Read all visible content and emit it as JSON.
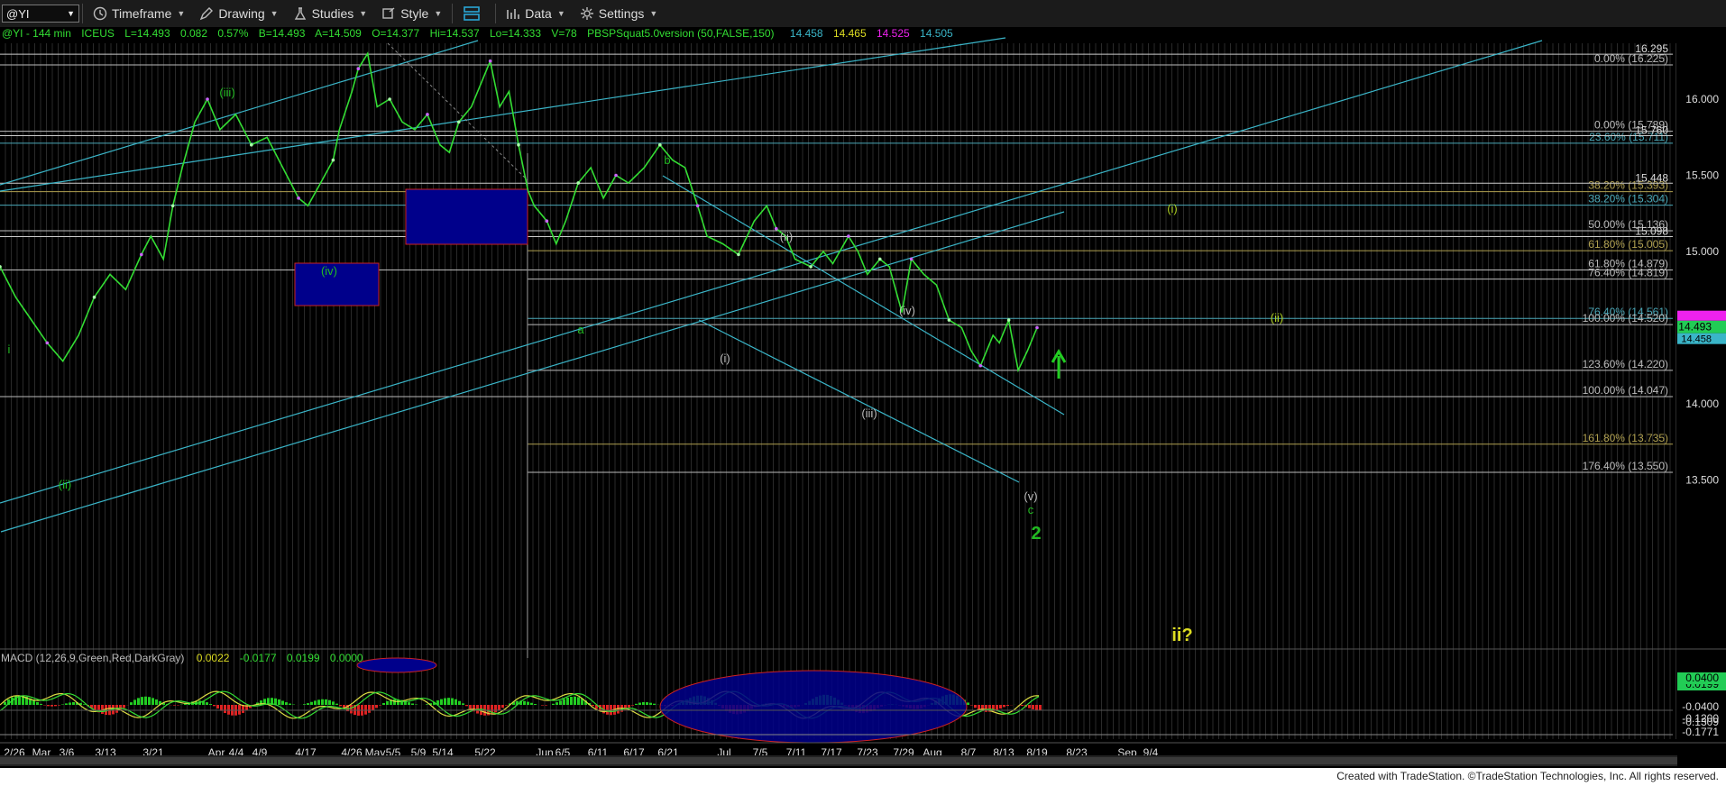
{
  "toolbar": {
    "symbol": "@YI",
    "timeframe": "Timeframe",
    "drawing": "Drawing",
    "studies": "Studies",
    "style": "Style",
    "data": "Data",
    "settings": "Settings"
  },
  "info_bar": {
    "symbol_interval": "@YI - 144 min",
    "exchange": "ICEUS",
    "last": "L=14.493",
    "change": "0.082",
    "change_pct": "0.57%",
    "bid": "B=14.493",
    "ask": "A=14.509",
    "open": "O=14.377",
    "high": "Hi=14.537",
    "low": "Lo=14.333",
    "volume": "V=78",
    "study": "PBSPSquat5.0version (50,FALSE,150)",
    "study_values": [
      "14.458",
      "14.465",
      "14.525",
      "14.505"
    ]
  },
  "macd": {
    "title": "MACD (12,26,9,Green,Red,DarkGray)",
    "values": [
      "0.0022",
      "-0.0177",
      "0.0199",
      "0.0000"
    ]
  },
  "footer": "Created with TradeStation. ©TradeStation Technologies, Inc. All rights reserved.",
  "colors": {
    "price": "#33dd33",
    "channel": "#3ab5c8",
    "wave_green": "#22bb22",
    "wave_yellow_green": "#aacc22",
    "wave_gray": "#bbbbbb",
    "box_fill": "#00008b",
    "box_border": "#cc2222",
    "current_price_bg": "#22cc55",
    "magenta": "#ee22ee"
  },
  "chart_data": {
    "type": "line",
    "price_axis_labels": [
      "16.000",
      "15.500",
      "15.000",
      "14.500",
      "14.000",
      "13.500"
    ],
    "price_axis_values": [
      16.0,
      15.5,
      15.0,
      14.5,
      14.0,
      13.5
    ],
    "ylim": [
      13.35,
      16.35
    ],
    "price_side_labels": [
      {
        "text": "16.295",
        "value": 16.295
      },
      {
        "text": "15.760",
        "value": 15.76
      },
      {
        "text": "15.448",
        "value": 15.448
      },
      {
        "text": "15.098",
        "value": 15.098
      }
    ],
    "current_price": {
      "main": "14.493",
      "sub": "14.458"
    },
    "fib_levels": [
      {
        "text": "0.00% (16.225)",
        "value": 16.225,
        "color": "#bbbbbb"
      },
      {
        "text": "0.00% (15.789)",
        "value": 15.789,
        "color": "#bbbbbb"
      },
      {
        "text": "23.60% (15.711)",
        "value": 15.711,
        "color": "#4aa8b8"
      },
      {
        "text": "38.20% (15.393)",
        "value": 15.393,
        "color": "#b0a050"
      },
      {
        "text": "38.20% (15.304)",
        "value": 15.304,
        "color": "#4aa8b8"
      },
      {
        "text": "50.00% (15.136)",
        "value": 15.136,
        "color": "#bbbbbb"
      },
      {
        "text": "61.80% (15.005)",
        "value": 15.005,
        "color": "#b0a050"
      },
      {
        "text": "61.80% (14.879)",
        "value": 14.879,
        "color": "#bbbbbb"
      },
      {
        "text": "76.40% (14.819)",
        "value": 14.819,
        "color": "#bbbbbb"
      },
      {
        "text": "76.40% (14.561)",
        "value": 14.561,
        "color": "#4aa8b8"
      },
      {
        "text": "100.00% (14.520)",
        "value": 14.52,
        "color": "#bbbbbb"
      },
      {
        "text": "123.60% (14.220)",
        "value": 14.22,
        "color": "#bbbbbb"
      },
      {
        "text": "100.00% (14.047)",
        "value": 14.047,
        "color": "#bbbbbb"
      },
      {
        "text": "161.80% (13.735)",
        "value": 13.735,
        "color": "#b0a050"
      },
      {
        "text": "176.40% (13.550)",
        "value": 13.55,
        "color": "#bbbbbb"
      }
    ],
    "date_labels": [
      "2/26",
      "Mar",
      "3/6",
      "3/13",
      "3/21",
      "Apr",
      "4/4",
      "4/9",
      "4/17",
      "4/26",
      "May",
      "5/5",
      "5/9",
      "5/14",
      "5/22",
      "Jun",
      "6/5",
      "6/11",
      "6/17",
      "6/21",
      "Jul",
      "7/5",
      "7/11",
      "7/17",
      "7/23",
      "7/29",
      "Aug",
      "8/7",
      "8/13",
      "8/19",
      "8/23",
      "Sep",
      "9/4"
    ],
    "wave_labels": [
      {
        "text": "i",
        "color": "#22bb22"
      },
      {
        "text": "(ii)",
        "color": "#22bb22"
      },
      {
        "text": "(iii)",
        "color": "#22bb22"
      },
      {
        "text": "(iv)",
        "color": "#22bb22"
      },
      {
        "text": "a",
        "color": "#22bb22"
      },
      {
        "text": "b",
        "color": "#22bb22"
      },
      {
        "text": "(i)",
        "color": "#bbbbbb"
      },
      {
        "text": "(ii)",
        "color": "#bbbbbb"
      },
      {
        "text": "(iii)",
        "color": "#bbbbbb"
      },
      {
        "text": "(iv)",
        "color": "#bbbbbb"
      },
      {
        "text": "(v)",
        "color": "#bbbbbb"
      },
      {
        "text": "c",
        "color": "#22bb22"
      },
      {
        "text": "2",
        "color": "#22bb22"
      },
      {
        "text": "(i)",
        "color": "#aacc22"
      },
      {
        "text": "(ii)",
        "color": "#aacc22"
      },
      {
        "text": "ii?",
        "color": "#dddd22"
      }
    ],
    "macd_axis_labels": [
      {
        "text": "0.0199",
        "value": 0.0199,
        "highlight": "#22cc55"
      },
      {
        "text": "0.0400",
        "value": 0.04,
        "highlight": "#22cc55"
      },
      {
        "text": "-0.0400",
        "value": -0.04
      },
      {
        "text": "-0.1309",
        "value": -0.1309
      },
      {
        "text": "-0.1771",
        "value": -0.1771
      },
      {
        "text": "-0.1200",
        "value": -0.12
      }
    ],
    "path": [
      [
        0,
        14.9
      ],
      [
        5,
        14.7
      ],
      [
        10,
        14.55
      ],
      [
        15,
        14.4
      ],
      [
        20,
        14.28
      ],
      [
        25,
        14.45
      ],
      [
        30,
        14.7
      ],
      [
        35,
        14.85
      ],
      [
        40,
        14.75
      ],
      [
        45,
        14.98
      ],
      [
        48,
        15.1
      ],
      [
        52,
        14.95
      ],
      [
        55,
        15.3
      ],
      [
        58,
        15.55
      ],
      [
        62,
        15.85
      ],
      [
        66,
        16.0
      ],
      [
        70,
        15.8
      ],
      [
        75,
        15.9
      ],
      [
        80,
        15.7
      ],
      [
        85,
        15.75
      ],
      [
        90,
        15.55
      ],
      [
        95,
        15.35
      ],
      [
        98,
        15.3
      ],
      [
        102,
        15.45
      ],
      [
        106,
        15.6
      ],
      [
        108,
        15.8
      ],
      [
        112,
        16.05
      ],
      [
        114,
        16.2
      ],
      [
        117,
        16.3
      ],
      [
        120,
        15.95
      ],
      [
        124,
        16.0
      ],
      [
        128,
        15.85
      ],
      [
        132,
        15.8
      ],
      [
        136,
        15.9
      ],
      [
        140,
        15.7
      ],
      [
        143,
        15.65
      ],
      [
        146,
        15.85
      ],
      [
        150,
        15.95
      ],
      [
        153,
        16.1
      ],
      [
        156,
        16.25
      ],
      [
        159,
        15.95
      ],
      [
        162,
        16.05
      ],
      [
        165,
        15.7
      ],
      [
        168,
        15.4
      ],
      [
        170,
        15.3
      ],
      [
        174,
        15.2
      ],
      [
        177,
        15.05
      ],
      [
        180,
        15.2
      ],
      [
        184,
        15.45
      ],
      [
        188,
        15.55
      ],
      [
        192,
        15.35
      ],
      [
        196,
        15.5
      ],
      [
        200,
        15.45
      ],
      [
        205,
        15.55
      ],
      [
        210,
        15.7
      ],
      [
        214,
        15.6
      ],
      [
        218,
        15.55
      ],
      [
        222,
        15.3
      ],
      [
        225,
        15.1
      ],
      [
        230,
        15.05
      ],
      [
        235,
        14.98
      ],
      [
        240,
        15.2
      ],
      [
        244,
        15.3
      ],
      [
        247,
        15.15
      ],
      [
        250,
        15.1
      ],
      [
        253,
        14.95
      ],
      [
        258,
        14.9
      ],
      [
        262,
        15.0
      ],
      [
        265,
        14.92
      ],
      [
        270,
        15.1
      ],
      [
        273,
        15.0
      ],
      [
        276,
        14.85
      ],
      [
        280,
        14.95
      ],
      [
        283,
        14.9
      ],
      [
        287,
        14.6
      ],
      [
        290,
        14.95
      ],
      [
        294,
        14.85
      ],
      [
        298,
        14.78
      ],
      [
        302,
        14.55
      ],
      [
        306,
        14.5
      ],
      [
        309,
        14.35
      ],
      [
        312,
        14.25
      ],
      [
        316,
        14.45
      ],
      [
        318,
        14.4
      ],
      [
        321,
        14.55
      ],
      [
        324,
        14.22
      ],
      [
        327,
        14.35
      ],
      [
        330,
        14.5
      ]
    ]
  }
}
